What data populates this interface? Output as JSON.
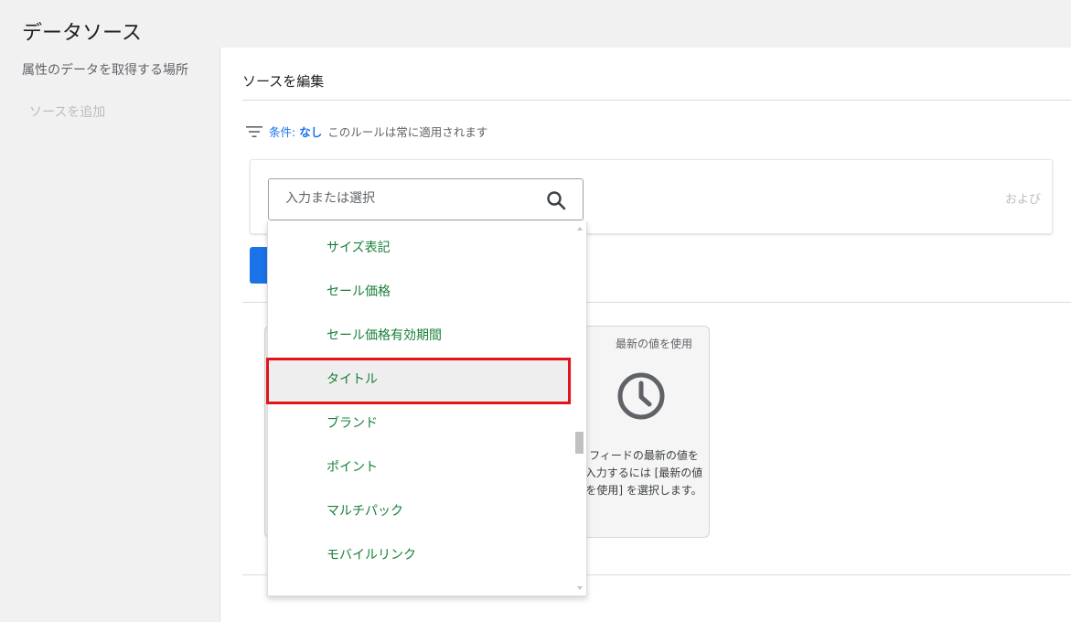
{
  "page": {
    "title": "データソース"
  },
  "sidebar": {
    "heading": "属性のデータを取得する場所",
    "add_source": "ソースを追加"
  },
  "panel": {
    "header": "ソースを編集",
    "condition": {
      "label": "条件:",
      "value": "なし",
      "note": "このルールは常に適用されます"
    },
    "and_label": "および"
  },
  "search": {
    "placeholder": "入力または選択",
    "value": ""
  },
  "dropdown": {
    "items": [
      {
        "label": "サイズ表記"
      },
      {
        "label": "セール価格"
      },
      {
        "label": "セール価格有効期間"
      },
      {
        "label": "タイトル"
      },
      {
        "label": "ブランド"
      },
      {
        "label": "ポイント"
      },
      {
        "label": "マルチパック"
      },
      {
        "label": "モバイルリンク"
      }
    ],
    "highlighted_index": 3,
    "item_color": "#188038"
  },
  "option_card": {
    "title": "最新の値を使用",
    "icon": "clock-icon",
    "description": "フィードの最新の値を入力するには [最新の値を使用] を選択します。"
  },
  "colors": {
    "accent": "#1a73e8",
    "highlight_border": "#e0141b"
  }
}
